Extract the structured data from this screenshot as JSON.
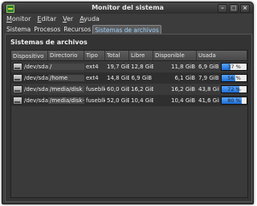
{
  "window": {
    "title": "Monitor del sistema"
  },
  "menubar": [
    "Monitor",
    "Editar",
    "Ver",
    "Ayuda"
  ],
  "tabs": [
    {
      "label": "Sistema",
      "active": false
    },
    {
      "label": "Procesos",
      "active": false
    },
    {
      "label": "Recursos",
      "active": false
    },
    {
      "label": "Sistemas de archivos",
      "active": true
    }
  ],
  "panel": {
    "title": "Sistemas de archivos"
  },
  "table": {
    "headers": [
      "Dispositivo",
      "Directorio",
      "Tipo",
      "Total",
      "Libre",
      "Disponible",
      "Usada"
    ],
    "rows": [
      {
        "device": "/dev/sda6",
        "directory": "/",
        "type": "ext4",
        "total": "19,7 GiB",
        "free": "12,8 GiB",
        "available": "11,8 GiB",
        "used": "6,9 GiB",
        "percent_label": "37 %",
        "percent": 37
      },
      {
        "device": "/dev/sda2",
        "directory": "/home",
        "type": "ext4",
        "total": "14,8 GiB",
        "free": "6,9 GiB",
        "available": "6,1 GiB",
        "used": "7,9 GiB",
        "percent_label": "56 %",
        "percent": 56
      },
      {
        "device": "/dev/sda1",
        "directory": "/media/disk",
        "type": "fuseblk",
        "total": "60,0 GiB",
        "free": "16,2 GiB",
        "available": "16,2 GiB",
        "used": "43,8 GiB",
        "percent_label": "72 %",
        "percent": 72
      },
      {
        "device": "/dev/sda7",
        "directory": "/media/disk-1",
        "type": "fuseblk",
        "total": "52,0 GiB",
        "free": "10,4 GiB",
        "available": "10,4 GiB",
        "used": "41,6 GiB",
        "percent_label": "80 %",
        "percent": 80
      }
    ]
  },
  "colors": {
    "progress": "#2f86f0",
    "window_bg": "#3c3c3c",
    "active_tab_text": "#9fd2ff"
  }
}
